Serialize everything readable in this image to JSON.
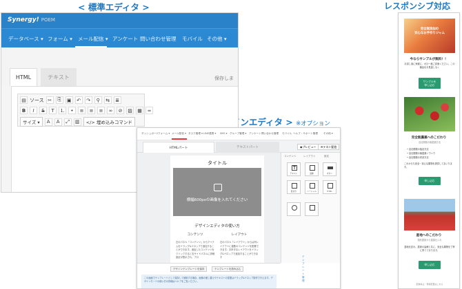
{
  "captions": {
    "standard": "< 標準エディタ >",
    "design": "< デザインエディタ >",
    "design_note": "※オプション",
    "responsive": "レスポンシブ対応"
  },
  "std": {
    "logo": "Synergy!",
    "logo_sub": "POEM",
    "nav": [
      "データベース ▾",
      "フォーム ▾",
      "メール配信 ▾",
      "アンケート",
      "問い合わせ管理",
      "モバイル",
      "その他 ▾"
    ],
    "tabs": [
      "HTML",
      "テキスト"
    ],
    "hozon": "保存しま",
    "toolbar_source": "ソース",
    "toolbar_size": "サイズ",
    "toolbar_embed": "埋め込みコマンド"
  },
  "des": {
    "topnav": [
      "ダッシュボード",
      "フォーム ▾",
      "メール配信 ▾",
      "タスク管理 ▾",
      "LINE連携 ▾",
      "SMS ▾",
      "グループ管理 ▾",
      "アンケート",
      "問い合わせ管理",
      "モバイル",
      "ヘルプ・サポート管理",
      "その他 ▾"
    ],
    "tabs": [
      "HTMLパート",
      "テキストパート"
    ],
    "preview_btn": "プレビュー",
    "test_btn": "テスト配信",
    "title": "タイトル",
    "image_text": "横幅600pxの画像を入れてください",
    "howto": "デザインエディタの使い方",
    "col1_h": "コンテンツ",
    "col2_h": "レイアウト",
    "col1_p": "左のパネル「コンテンツ」からアイテムをドラッグ&ドロップで追加することができます。追加したコンテンツをクリックすると右サイドパネルに詳細設定が表示され、プロ",
    "col2_p": "左のパネル「レイアウト」からは列レイアウトに複数のコンテンツを配置できます。お好きなレイアウトをドラッグ&ドロップで追加することができます",
    "side_tabs": [
      "コンテンツ",
      "レイアウト",
      "設定"
    ],
    "blocks": [
      "テキスト",
      "画像",
      "ボタン",
      "区切り",
      "ソーシャル",
      "HTML"
    ],
    "foot_btns": [
      "デザインテンプレートを保存",
      "テンプレートを読み込む"
    ],
    "foot_right": "テンプレート管理",
    "note": "この画面でテンプレートとして保存して使用する場合、画像の差し替えやテキストの変更はドラッグ&ドロップ操作で行えます。デザインモードの使い方の詳細はヘルプをご覧ください。"
  },
  "resp": {
    "s1_title": "完全無添加の\n安心なお手作りジャム",
    "s1_head": "今ならサンプルが無料！！",
    "s1_text": "お試し用に気軽に、ぜひ一度ご試食ください。この機会をお見逃しなく",
    "s1_btn": "サンプルを\n申し込む",
    "s2_head": "完全無農薬へのこだわり",
    "s2_sub": "自社開発の無農薬方法",
    "s2_list": [
      "自社開発の独自方法",
      "自社開発の無農薬ノウハウ",
      "自社開発の完熟方法"
    ],
    "s2_text": "これからも安全・安心な果物を提供してまいります。",
    "s2_btn": "申し込む",
    "s3_head": "産地へのこだわり",
    "s3_sub": "契約農家から直接仕入れ",
    "s3_text": "農地を訪れ、農家の皆様と共に、安全な果物を丁寧に育てております。",
    "s3_btn": "申し込む",
    "footer": "配信停止・登録変更はこちら"
  },
  "colors": {
    "primary": "#2a82c8",
    "green": "#2a9a70",
    "red": "#e73a3a"
  }
}
